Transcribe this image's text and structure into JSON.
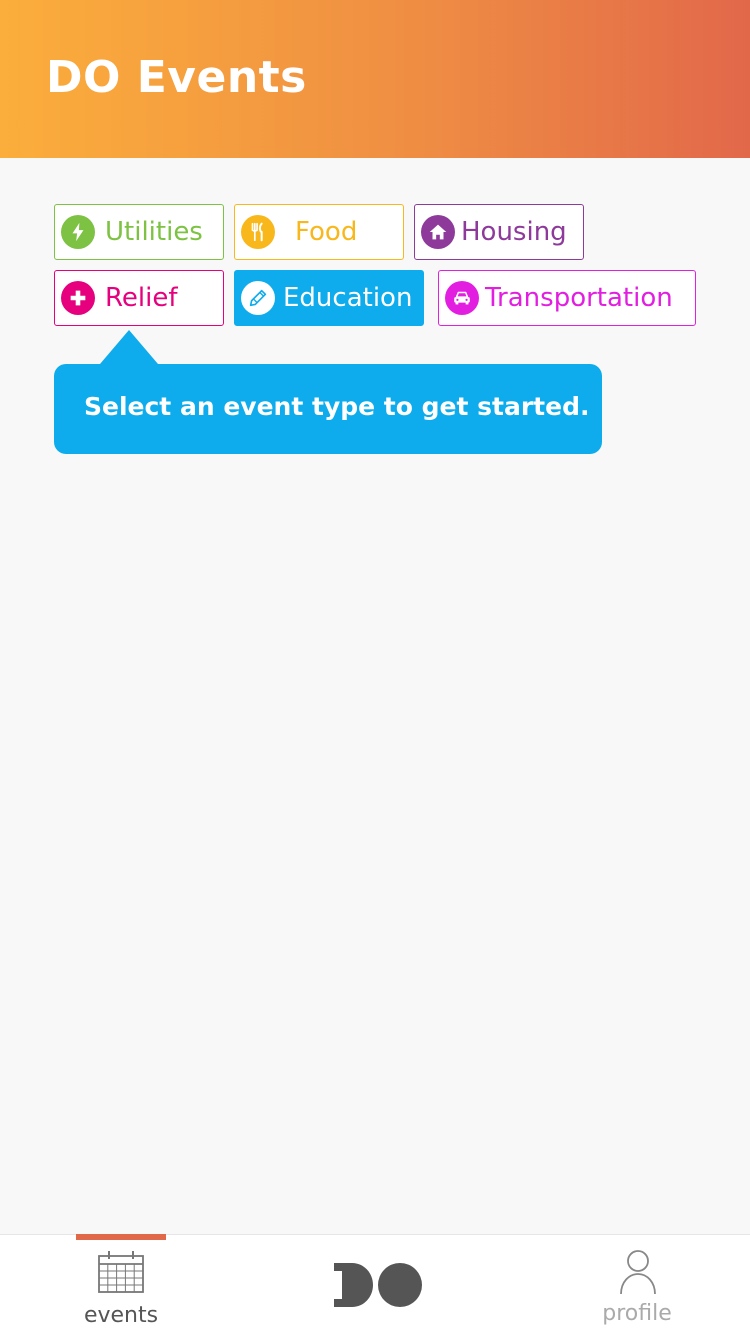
{
  "header": {
    "title": "DO Events"
  },
  "categories": [
    {
      "label": "Utilities",
      "icon": "lightning-icon",
      "color": "#7dc242"
    },
    {
      "label": "Food",
      "icon": "fork-knife-icon",
      "color": "#f8b81c"
    },
    {
      "label": "Housing",
      "icon": "house-icon",
      "color": "#8e3a9b"
    },
    {
      "label": "Relief",
      "icon": "plus-cross-icon",
      "color": "#e6007e"
    },
    {
      "label": "Education",
      "icon": "pencil-icon",
      "color": "#0eacec",
      "selected": true
    },
    {
      "label": "Transportation",
      "icon": "car-icon",
      "color": "#e21ee0"
    }
  ],
  "tooltip": {
    "text": "Select an event type to get started."
  },
  "tabbar": {
    "events_label": "events",
    "home_label": "DO",
    "profile_label": "profile",
    "active": "events",
    "accent": "#e2684a"
  }
}
